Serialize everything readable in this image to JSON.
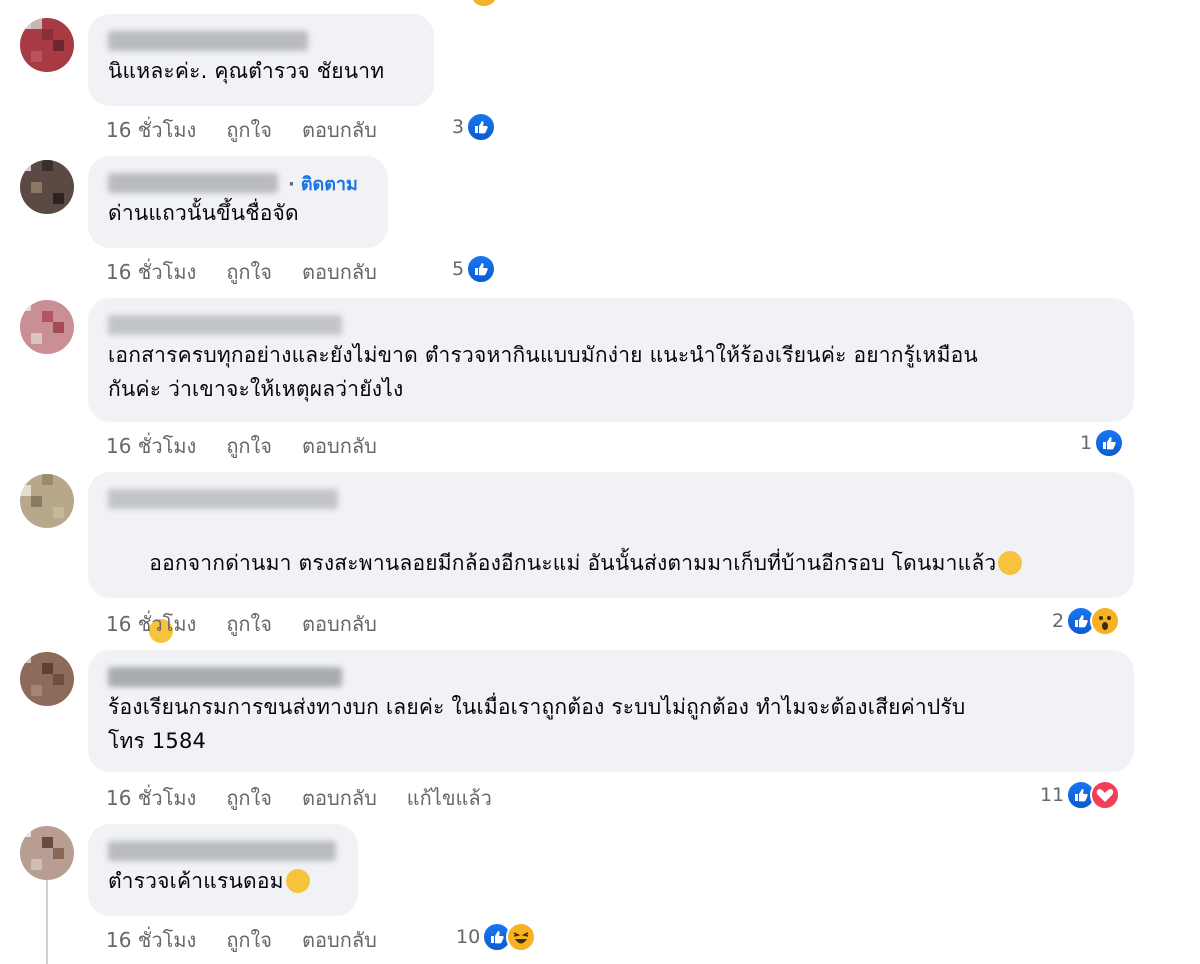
{
  "comments": [
    {
      "text": "นิแหละค่ะ. คุณตำรวจ ชัยนาท",
      "time": "16 ชั่วโมง",
      "like": "ถูกใจ",
      "reply": "ตอบกลับ",
      "reaction_count": "3",
      "reactions": [
        "like-icon"
      ]
    },
    {
      "follow": "ติดตาม",
      "text": "ด่านแถวนั้นขึ้นชื่อจัด",
      "time": "16 ชั่วโมง",
      "like": "ถูกใจ",
      "reply": "ตอบกลับ",
      "reaction_count": "5",
      "reactions": [
        "like-icon"
      ]
    },
    {
      "text": "เอกสารครบทุกอย่างและยังไม่ขาด ตำรวจหากินแบบมักง่าย แนะนำให้ร้องเรียนค่ะ อยากรู้เหมือน\nกันค่ะ ว่าเขาจะให้เหตุผลว่ายังไง",
      "time": "16 ชั่วโมง",
      "like": "ถูกใจ",
      "reply": "ตอบกลับ",
      "reaction_count": "1",
      "reactions": [
        "like-icon"
      ]
    },
    {
      "text": "ออกจากด่านมา ตรงสะพานลอยมีกล้องอีกนะแม่ อันนั้นส่งตามมาเก็บที่บ้านอีกรอบ โดนมาแล้ว",
      "time": "16 ชั่วโมง",
      "like": "ถูกใจ",
      "reply": "ตอบกลับ",
      "reaction_count": "2",
      "reactions": [
        "like-icon",
        "wow-icon"
      ]
    },
    {
      "text": "ร้องเรียนกรมการขนส่งทางบก เลยค่ะ ในเมื่อเราถูกต้อง ระบบไม่ถูกต้อง ทำไมจะต้องเสียค่าปรับ\nโทร 1584",
      "time": "16 ชั่วโมง",
      "like": "ถูกใจ",
      "reply": "ตอบกลับ",
      "edited": "แก้ไขแล้ว",
      "reaction_count": "11",
      "reactions": [
        "like-icon",
        "love-icon"
      ]
    },
    {
      "text": "ตำรวจเค้าแรนดอม",
      "time": "16 ชั่วโมง",
      "like": "ถูกใจ",
      "reply": "ตอบกลับ",
      "reaction_count": "10",
      "reactions": [
        "like-icon",
        "haha-icon"
      ]
    }
  ],
  "colors": {
    "bubble": "#f0f2f5",
    "meta": "#65676b",
    "accent": "#1877f2",
    "love": "#f33e58",
    "emoji": "#f7b125"
  }
}
